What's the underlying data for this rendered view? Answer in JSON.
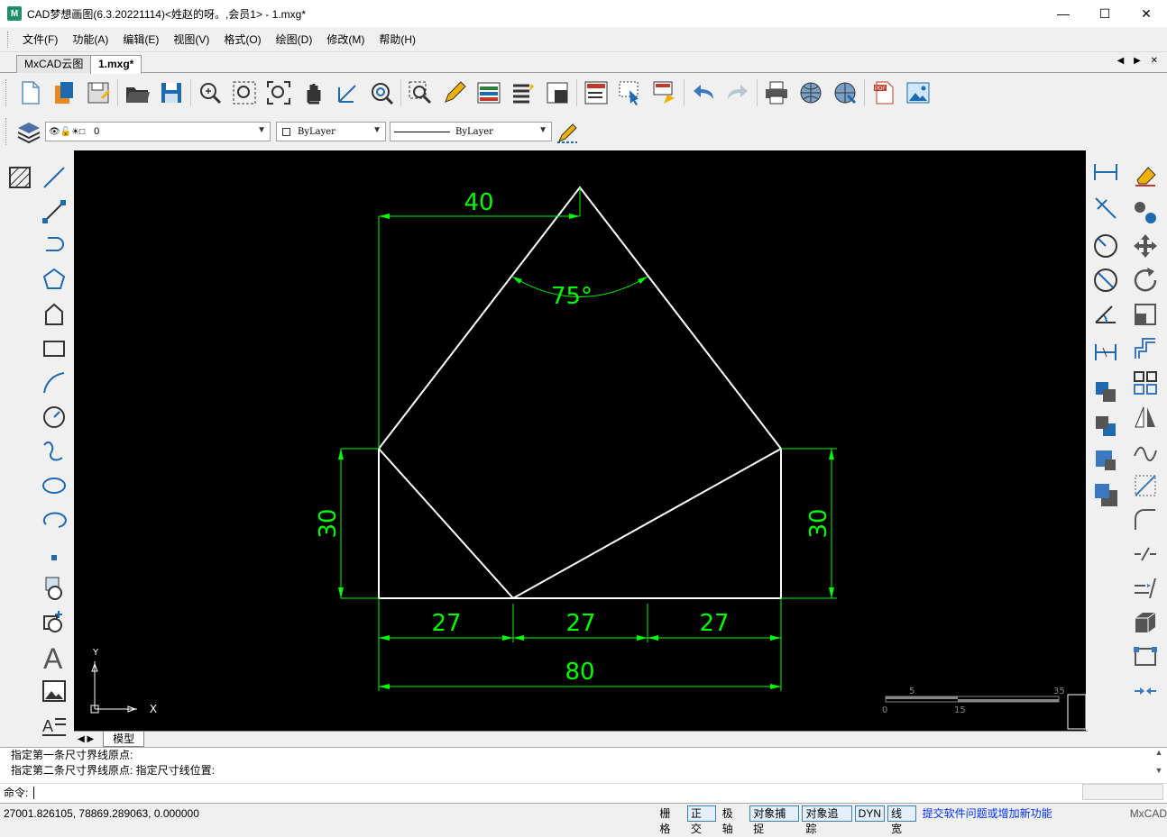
{
  "window": {
    "logo": "M",
    "title": "CAD梦想画图(6.3.20221114)<姓赵的呀。,会员1> - 1.mxg*",
    "minimize": "—",
    "maximize": "☐",
    "close": "✕"
  },
  "menu": [
    "文件(F)",
    "功能(A)",
    "编辑(E)",
    "视图(V)",
    "格式(O)",
    "绘图(D)",
    "修改(M)",
    "帮助(H)"
  ],
  "tabs": [
    {
      "label": "MxCAD云图"
    },
    {
      "label": "1.mxg*"
    }
  ],
  "tab_arrows": "◀ ▶ ✕",
  "layer_bar": {
    "layer_value": "0",
    "color_value": "ByLayer",
    "linetype_value": "ByLayer"
  },
  "drawing": {
    "dim_top": "40",
    "dim_angle": "75°",
    "dim_left": "30",
    "dim_right": "30",
    "dim_bottom_1": "27",
    "dim_bottom_2": "27",
    "dim_bottom_3": "27",
    "dim_total": "80",
    "ucs_y": "Y",
    "ucs_x": "X",
    "scale_labels": [
      "5",
      "35",
      "0",
      "15"
    ]
  },
  "model_tab": "模型",
  "command": {
    "history": [
      "指定第一条尺寸界线原点:",
      "指定第二条尺寸界线原点:  指定尺寸线位置:"
    ],
    "prompt": "命令:"
  },
  "status": {
    "coords": "27001.826105,  78869.289063,  0.000000",
    "toggles": [
      {
        "label": "栅格",
        "on": false
      },
      {
        "label": "正交",
        "on": true
      },
      {
        "label": "极轴",
        "on": false
      },
      {
        "label": "对象捕捉",
        "on": true
      },
      {
        "label": "对象追踪",
        "on": true
      },
      {
        "label": "DYN",
        "on": true
      },
      {
        "label": "线宽",
        "on": true
      }
    ],
    "link": "提交软件问题或增加新功能",
    "brand": "MxCAD"
  },
  "colors": {
    "dimension": "#00ff00",
    "geometry": "#ffffff",
    "canvas": "#000000"
  }
}
